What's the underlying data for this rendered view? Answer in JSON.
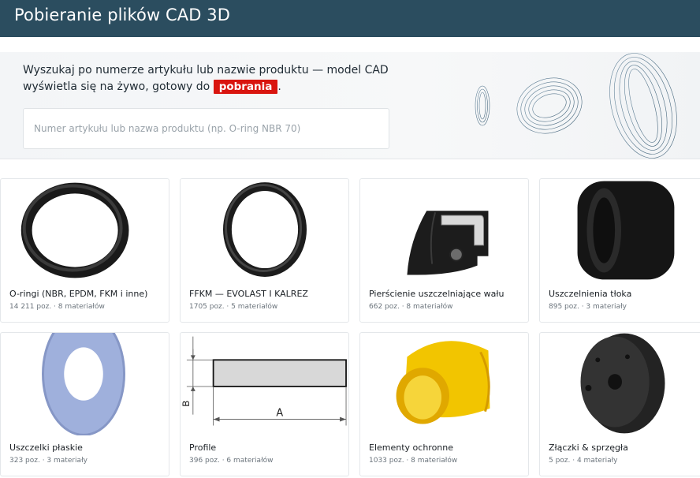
{
  "header": {
    "title": "Pobieranie plików CAD 3D"
  },
  "hero": {
    "line1": "Wyszukaj po numerze artykułu lub nazwie produktu — model CAD",
    "line2_prefix": "wyświetla się na żywo, gotowy do",
    "highlight": "pobrania",
    "line2_suffix": ".",
    "search_placeholder": "Numer artykułu lub nazwa produktu (np. O-ring NBR 70)",
    "search_value": ""
  },
  "categories": [
    {
      "title": "O-ringi (NBR, EPDM, FKM i inne)",
      "meta": "14 211 poz. · 8 materiałów",
      "image": "oring-black"
    },
    {
      "title": "FFKM — EVOLAST I KALREZ",
      "meta": "1705 poz. · 5 materiałów",
      "image": "oring-thin"
    },
    {
      "title": "Pierścienie uszczelniające wału",
      "meta": "662 poz. · 8 materiałów",
      "image": "shaft-seal"
    },
    {
      "title": "Uszczelnienia tłoka",
      "meta": "895 poz. · 3 materiały",
      "image": "piston-seal"
    },
    {
      "title": "Uszczelki płaskie",
      "meta": "323 poz. · 3 materiały",
      "image": "flat-gasket"
    },
    {
      "title": "Profile",
      "meta": "396 poz. · 6 materiałów",
      "image": "profile-drawing",
      "dim_a": "A",
      "dim_b": "B"
    },
    {
      "title": "Elementy ochronne",
      "meta": "1033 poz. · 8 materiałów",
      "image": "yellow-cap"
    },
    {
      "title": "Złączki & sprzęgła",
      "meta": "5 poz. · 4 materiały",
      "image": "coupling"
    }
  ]
}
